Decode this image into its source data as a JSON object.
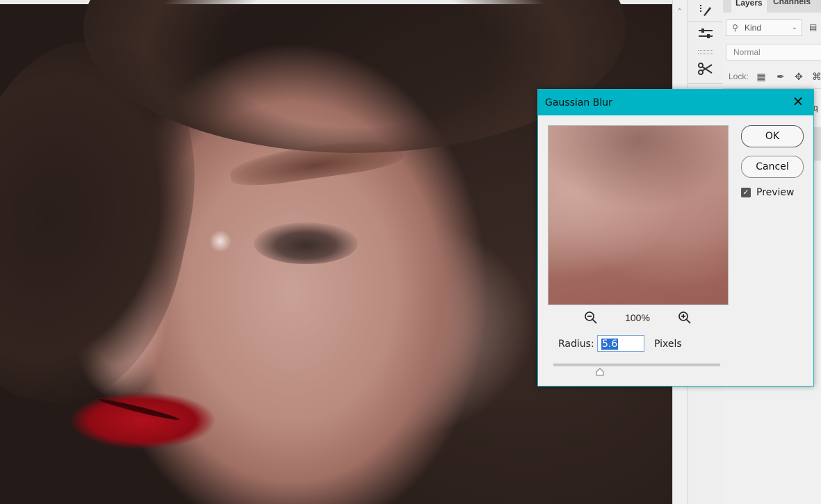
{
  "panel": {
    "tabs": [
      "Layers",
      "Channels"
    ],
    "kind_filter": "Kind",
    "blend_mode": "Normal",
    "lock_label": "Lock:",
    "partial_letter": "q"
  },
  "dialog": {
    "title": "Gaussian Blur",
    "ok_label": "OK",
    "cancel_label": "Cancel",
    "preview_label": "Preview",
    "preview_checked": true,
    "zoom_level": "100%",
    "radius_label": "Radius:",
    "radius_value": "5.6",
    "radius_units": "Pixels",
    "radius_slider_fraction": 0.28,
    "accent_color": "#00b4c6"
  },
  "icons": [
    "brush-icon",
    "adjustments-icon",
    "scissors-icon",
    "search-icon",
    "image-filter-icon",
    "lock-transparency-icon",
    "lock-paint-icon",
    "lock-move-icon",
    "lock-artboard-icon",
    "zoom-out-icon",
    "zoom-in-icon",
    "close-icon",
    "checkbox-check-icon"
  ]
}
